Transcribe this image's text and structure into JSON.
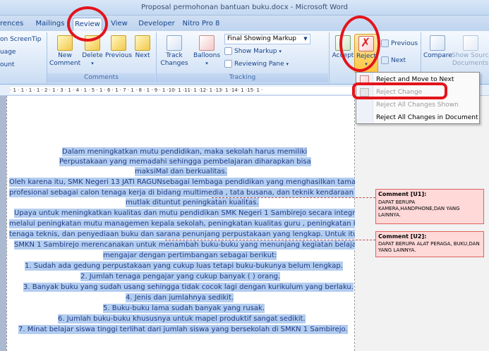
{
  "window": {
    "title": "Proposal permohonan bantuan buku.docx - Microsoft Word"
  },
  "tabs": [
    {
      "label": "rences"
    },
    {
      "label": "Mailings"
    },
    {
      "label": "Review"
    },
    {
      "label": "View"
    },
    {
      "label": "Developer"
    },
    {
      "label": "Nitro Pro 8"
    }
  ],
  "ribbon": {
    "proofing": {
      "screentip": "on ScreenTip",
      "language": "uage",
      "count": "ount"
    },
    "comments": {
      "group_label": "Comments",
      "new_comment": "New\nComment",
      "delete": "Delete",
      "previous": "Previous",
      "next": "Next"
    },
    "tracking": {
      "group_label": "Tracking",
      "track_changes": "Track\nChanges",
      "balloons": "Balloons",
      "display_value": "Final Showing Markup",
      "show_markup": "Show Markup",
      "reviewing_pane": "Reviewing Pane"
    },
    "changes": {
      "accept": "Accept",
      "reject": "Reject",
      "previous": "Previous",
      "next": "Next"
    },
    "compare": {
      "compare": "Compare",
      "show_source": "Show Source\nDocuments"
    }
  },
  "reject_menu": [
    {
      "label": "Reject and Move to Next",
      "enabled": true
    },
    {
      "label": "Reject Change",
      "enabled": false
    },
    {
      "label": "Reject All Changes Shown",
      "enabled": false
    },
    {
      "label": "Reject All Changes in Document",
      "enabled": true
    }
  ],
  "ruler_text": "· 1 · 1 · 1 · 1 · 2 · 1 · 3 · 1 · 4 · 1 · 5 · 1 · 6 · 1 · 7 · 1 · 8 · 1 · 9 · 1 ·10· 1 ·11· 1 ·12· 1 ·13· 1 ·14· 1 ·15· 1 ·",
  "document": {
    "lines": [
      "Dalam meningkatkan mutu pendidikan, maka sekolah harus memiliki",
      "Perpustakaan yang memadahi sehingga pembelajaran diharapkan bisa",
      "maksiMal dan berkualitas.",
      "Oleh karena itu, SMK Negeri 13 JATI RAGUNsebagai lembaga pendidikan yang menghasilkan tamatan",
      "profesional sebagai calon tenaga kerja di bidang  multimedia , tata busana, dan teknik kendaraan ringan",
      "mutlak dituntut peningkatan kualitas.",
      "Upaya untuk meningkatkan kualitas dan mutu pendidikan SMK  Negeri 1 Sambirejo secara integritas",
      "melalui peningkatan mutu managemen kepala sekolah, peningkatan kualitas guru , peningkatan kualitas",
      "tenaga teknis, dan penyediaan buku dan sarana penunjang perpustakaan yang lengkap. Untuk itulah",
      "SMKN 1 Sambirejo merencanakan untuk menambah buku-buku yang menunjang kegiatan belajar",
      "mengajar dengan pertimbangan sebagai berikut:",
      "1.    Sudah ada gedung perpustakaan yang cukup luas tetapi buku-bukunya belum lengkap.",
      "2.    Jumlah tenaga pengajar yang cukup banyak (    ) orang.",
      "3.    Banyak buku yang sudah usang sehingga tidak cocok lagi dengan kurikulum yang berlaku.",
      "4.    Jenis dan jumlahnya sedikit.",
      "5.    Buku-buku lama sudah banyak yang rusak.",
      "6.    Jumlah buku-buku khususnya untuk mapel produktif sangat sedikit.",
      "7.    Minat belajar siswa tinggi terlihat dari jumlah siswa yang bersekolah di SMKN 1 Sambirejo."
    ]
  },
  "comments": [
    {
      "title": "Comment [U1]:",
      "body": "DAPAT BERUPA\nKAMERA,HANDPHONE,DAN YANG\nLAINNYA."
    },
    {
      "title": "Comment [U2]:",
      "body": "DAPAT BERUPA ALAT PERAGA, BUKU,DAN\nYANG LAINNYA."
    }
  ],
  "colors": {
    "annotation_red": "#e3141b",
    "selection": "#b3cdf0",
    "comment_fill": "#ffd8d8"
  }
}
